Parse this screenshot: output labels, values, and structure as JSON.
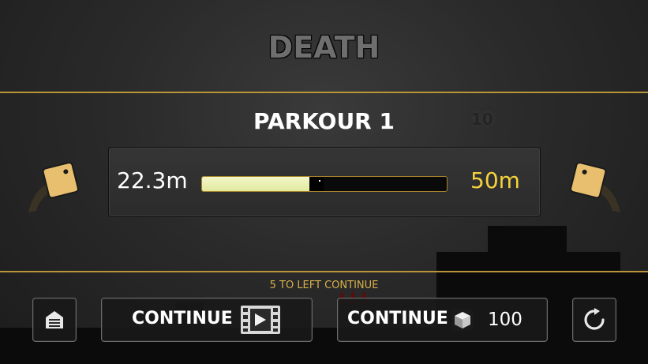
{
  "screen": {
    "title": "DEATH",
    "level_name": "PARKOUR 1",
    "level_badge": "10"
  },
  "progress": {
    "current_label": "22.3m",
    "goal_label": "50m",
    "fraction": 0.446
  },
  "notice": "5 TO LEFT CONTINUE",
  "buttons": {
    "home_icon": "home-icon",
    "continue_video_label": "CONTINUE",
    "continue_video_icon": "video-ad-icon",
    "continue_cube_label": "CONTINUE",
    "continue_cube_icon": "cube-icon",
    "continue_cube_cost": "100",
    "restart_icon": "restart-icon"
  },
  "colors": {
    "accent_line": "#b8953a",
    "goal_text": "#f4d23c",
    "notice_text": "#d8b14a",
    "progress_fill": "#e9efb0",
    "cube_character": "#e8bf6f"
  }
}
